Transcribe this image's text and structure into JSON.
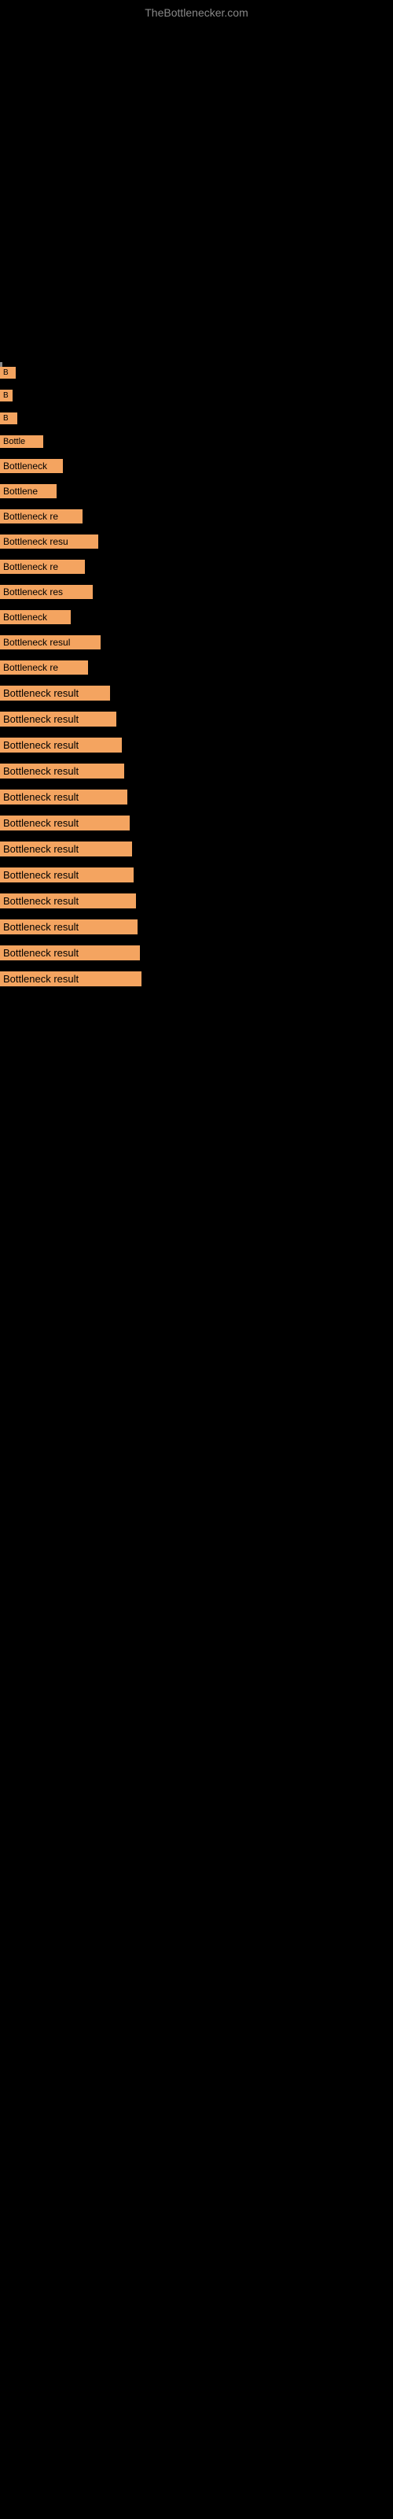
{
  "site": {
    "title": "TheBottlenecker.com"
  },
  "items": [
    {
      "label": "B",
      "class": "item-0"
    },
    {
      "label": "B",
      "class": "item-1"
    },
    {
      "label": "B",
      "class": "item-2"
    },
    {
      "label": "Bottle",
      "class": "item-3"
    },
    {
      "label": "Bottleneck",
      "class": "item-4"
    },
    {
      "label": "Bottlene",
      "class": "item-5"
    },
    {
      "label": "Bottleneck re",
      "class": "item-6"
    },
    {
      "label": "Bottleneck resu",
      "class": "item-7"
    },
    {
      "label": "Bottleneck re",
      "class": "item-8"
    },
    {
      "label": "Bottleneck res",
      "class": "item-9"
    },
    {
      "label": "Bottleneck",
      "class": "item-10"
    },
    {
      "label": "Bottleneck resul",
      "class": "item-11"
    },
    {
      "label": "Bottleneck re",
      "class": "item-12"
    },
    {
      "label": "Bottleneck result",
      "class": "item-13"
    },
    {
      "label": "Bottleneck result",
      "class": "item-14"
    },
    {
      "label": "Bottleneck result",
      "class": "item-15"
    },
    {
      "label": "Bottleneck result",
      "class": "item-16"
    },
    {
      "label": "Bottleneck result",
      "class": "item-17"
    },
    {
      "label": "Bottleneck result",
      "class": "item-18"
    },
    {
      "label": "Bottleneck result",
      "class": "item-19"
    },
    {
      "label": "Bottleneck result",
      "class": "item-20"
    },
    {
      "label": "Bottleneck result",
      "class": "item-21"
    },
    {
      "label": "Bottleneck result",
      "class": "item-22"
    },
    {
      "label": "Bottleneck result",
      "class": "item-23"
    },
    {
      "label": "Bottleneck result",
      "class": "item-24"
    }
  ]
}
